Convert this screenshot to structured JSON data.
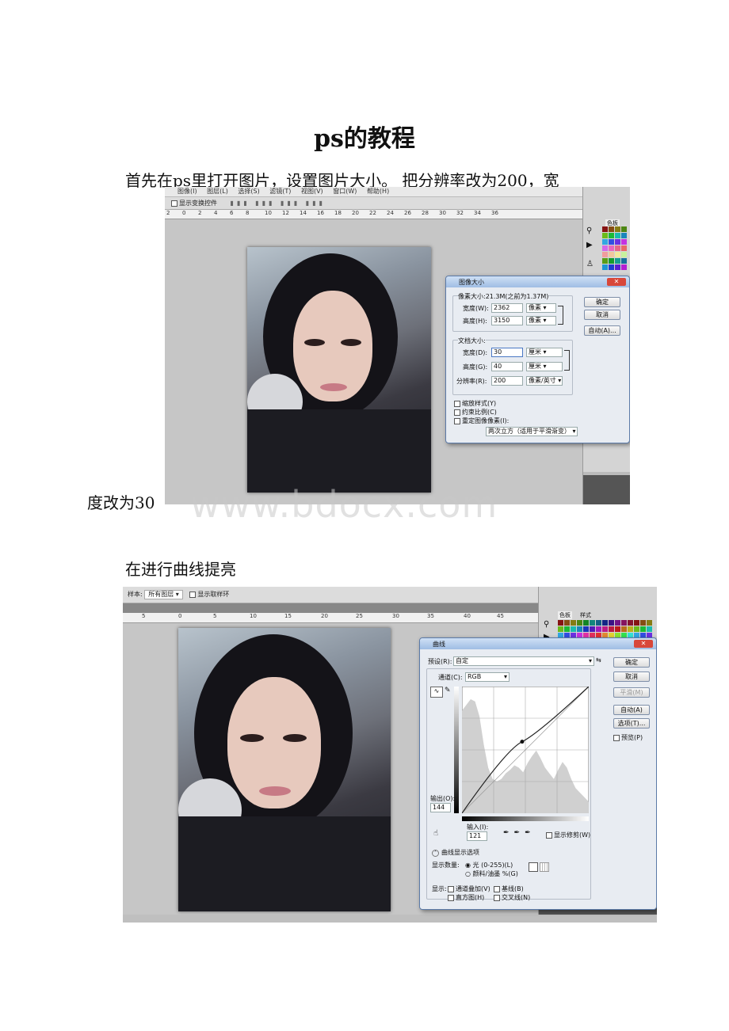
{
  "title": "ps的教程",
  "paragraphs": {
    "p1": "首先在ps里打开图片，设置图片大小。 把分辨率改为200，宽",
    "p1_cont": "度改为30",
    "p2": "在进行曲线提亮"
  },
  "watermark": "www.bdocx.com",
  "shot1": {
    "menus": [
      "图像(I)",
      "图层(L)",
      "选择(S)",
      "滤镜(T)",
      "视图(V)",
      "窗口(W)",
      "帮助(H)"
    ],
    "option_checkbox": "显示变换控件",
    "ruler_ticks": [
      "2",
      "0",
      "2",
      "4",
      "6",
      "8",
      "10",
      "12",
      "14",
      "16",
      "18",
      "20",
      "22",
      "24",
      "26",
      "28",
      "30",
      "32",
      "34",
      "36"
    ],
    "panel_tab": "色板",
    "dialog": {
      "title": "图像大小",
      "pixel_group": "像素大小:21.3M(之前为1.37M)",
      "width_label": "宽度(W):",
      "width_value": "2362",
      "width_unit": "像素",
      "height_label": "高度(H):",
      "height_value": "3150",
      "height_unit": "像素",
      "doc_group": "文档大小:",
      "doc_width_label": "宽度(D):",
      "doc_width_value": "30",
      "doc_width_unit": "厘米",
      "doc_height_label": "高度(G):",
      "doc_height_value": "40",
      "doc_height_unit": "厘米",
      "res_label": "分辨率(R):",
      "res_value": "200",
      "res_unit": "像素/英寸",
      "cb1": "缩放样式(Y)",
      "cb2": "约束比例(C)",
      "cb3": "重定图像像素(I):",
      "resample": "两次立方（适用于平滑渐变）",
      "ok": "确定",
      "cancel": "取消",
      "auto": "自动(A)..."
    }
  },
  "shot2": {
    "option_sample_label": "样本:",
    "option_sample_value": "所有图层",
    "option_checkbox": "显示取样环",
    "ruler_ticks": [
      "5",
      "0",
      "5",
      "10",
      "15",
      "20",
      "25",
      "30",
      "35",
      "40",
      "45"
    ],
    "panel_tabs": [
      "色板",
      "样式"
    ],
    "dialog": {
      "title": "曲线",
      "preset_label": "预设(R):",
      "preset_value": "自定",
      "channel_label": "通道(C):",
      "channel_value": "RGB",
      "output_label": "输出(O):",
      "output_value": "144",
      "input_label": "输入(I):",
      "input_value": "121",
      "show_clipping": "显示修剪(W)",
      "options_header": "曲线显示选项",
      "amount_label": "显示数量:",
      "amount_light": "光 (0-255)(L)",
      "amount_pigment": "颜料/油墨 %(G)",
      "show_label": "显示:",
      "cb_overlay": "通道叠加(V)",
      "cb_baseline": "基线(B)",
      "cb_histogram": "直方图(H)",
      "cb_intersection": "交叉线(N)",
      "ok": "确定",
      "cancel": "取消",
      "smooth": "平滑(M)",
      "auto": "自动(A)",
      "options": "选项(T)...",
      "preview": "预览(P)",
      "curve": {
        "input": 121,
        "output": 144,
        "range": [
          0,
          255
        ]
      }
    }
  }
}
